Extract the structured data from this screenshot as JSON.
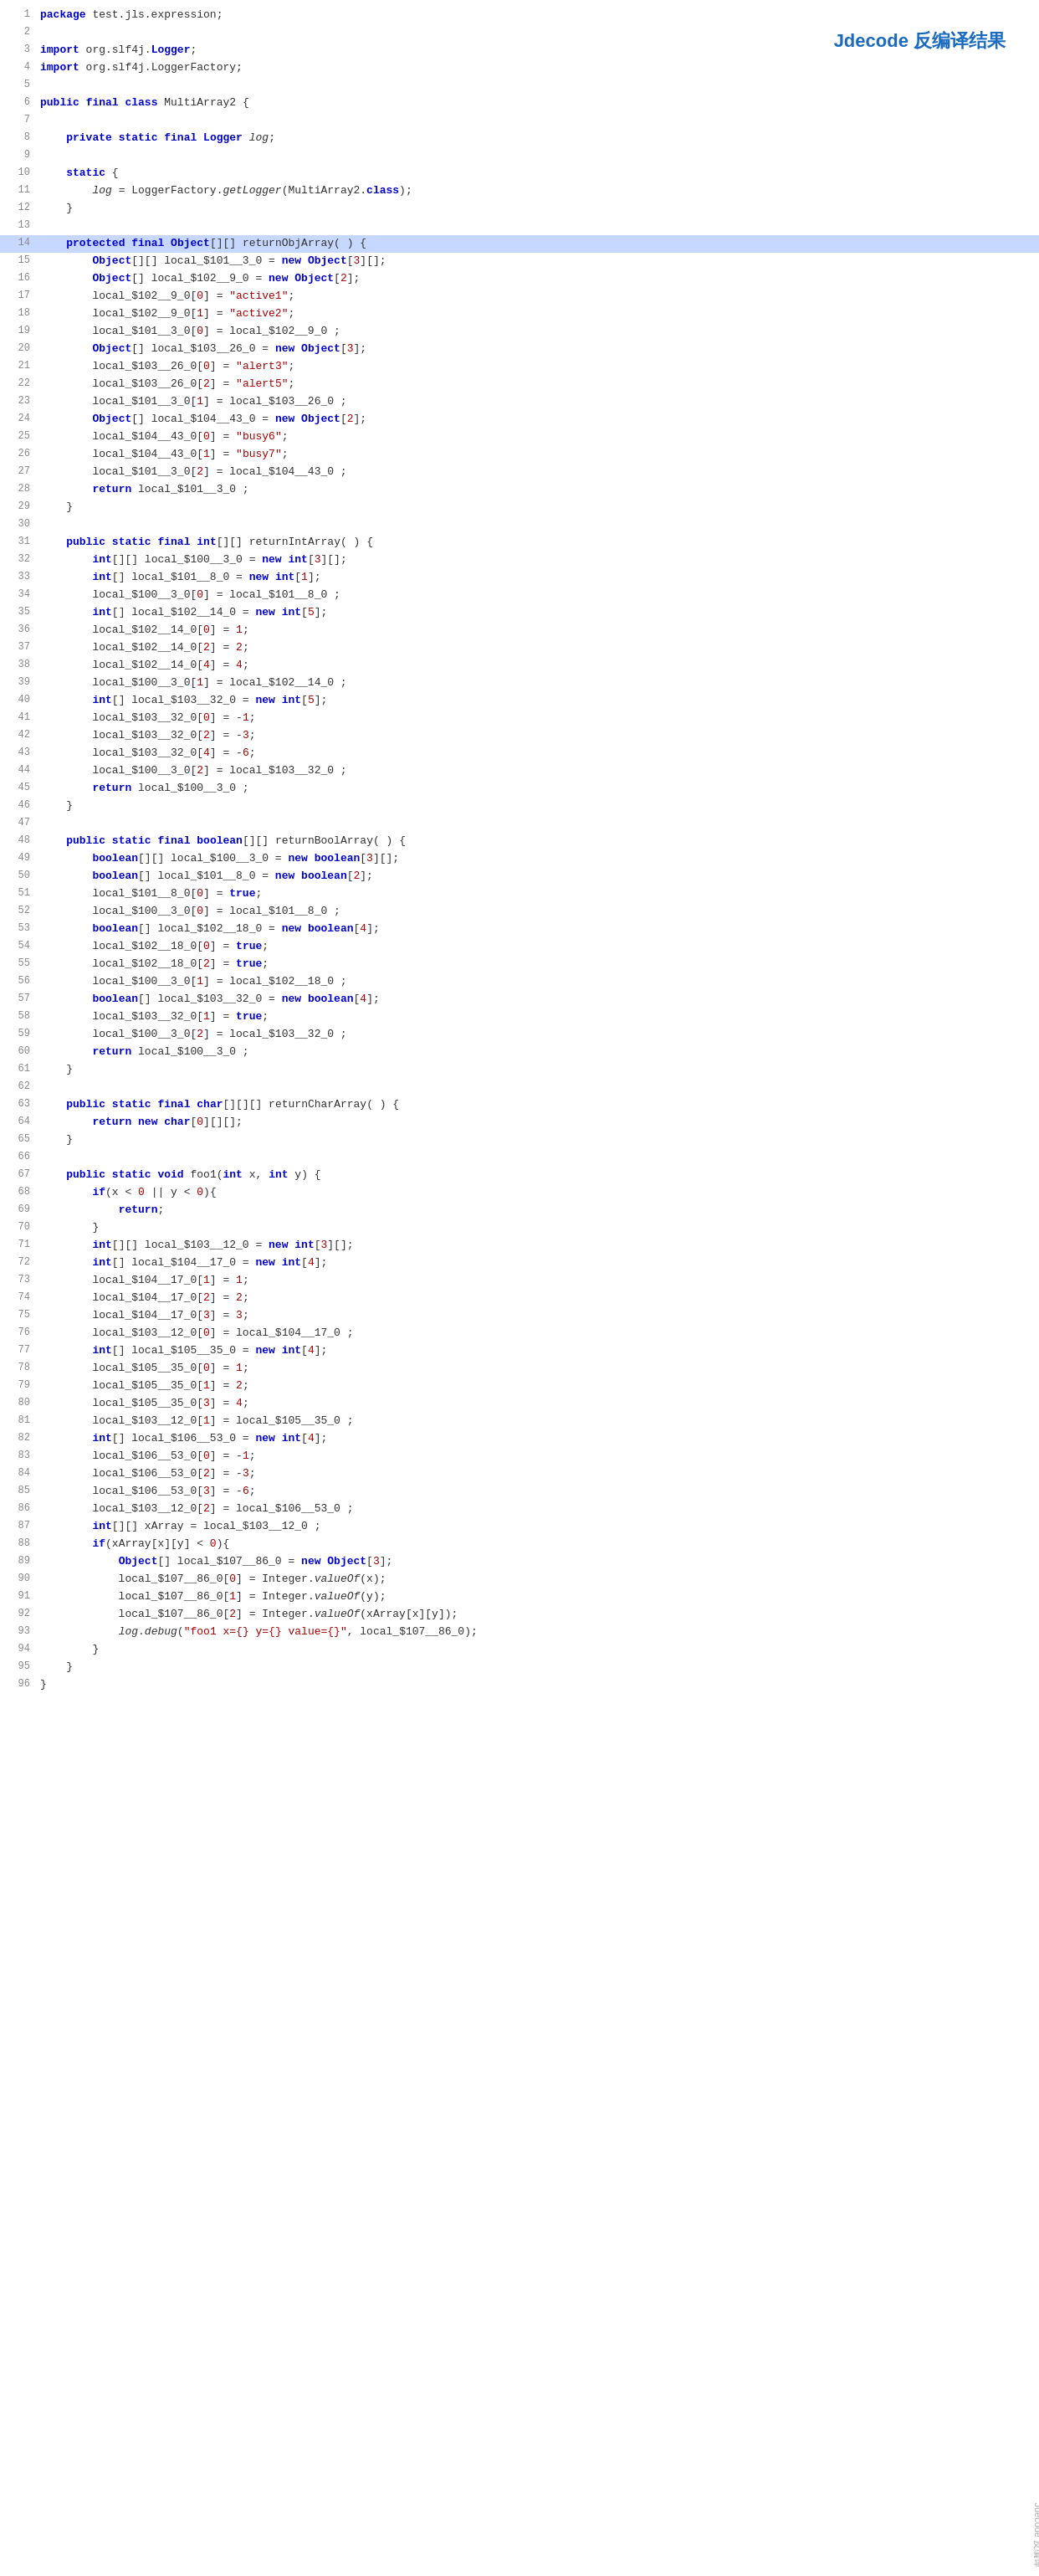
{
  "title": "Jdecode 反编译结果",
  "watermark": "Jdecode 反编译",
  "lines": [
    {
      "num": 1,
      "text": "package test.jls.expression;"
    },
    {
      "num": 2,
      "text": ""
    },
    {
      "num": 3,
      "text": "import org.slf4j.Logger;"
    },
    {
      "num": 4,
      "text": "import org.slf4j.LoggerFactory;"
    },
    {
      "num": 5,
      "text": ""
    },
    {
      "num": 6,
      "text": "public final class MultiArray2 {"
    },
    {
      "num": 7,
      "text": ""
    },
    {
      "num": 8,
      "text": "    private static final Logger log;"
    },
    {
      "num": 9,
      "text": ""
    },
    {
      "num": 10,
      "text": "    static {"
    },
    {
      "num": 11,
      "text": "        log = LoggerFactory.getLogger(MultiArray2.class);"
    },
    {
      "num": 12,
      "text": "    }"
    },
    {
      "num": 13,
      "text": ""
    },
    {
      "num": 14,
      "text": "    protected final Object[][] returnObjArray( ) {",
      "highlight": true
    },
    {
      "num": 15,
      "text": "        Object[][] local_$101__3_0 = new Object[3][];"
    },
    {
      "num": 16,
      "text": "        Object[] local_$102__9_0 = new Object[2];"
    },
    {
      "num": 17,
      "text": "        local_$102__9_0[0] = \"active1\";"
    },
    {
      "num": 18,
      "text": "        local_$102__9_0[1] = \"active2\";"
    },
    {
      "num": 19,
      "text": "        local_$101__3_0[0] = local_$102__9_0 ;"
    },
    {
      "num": 20,
      "text": "        Object[] local_$103__26_0 = new Object[3];"
    },
    {
      "num": 21,
      "text": "        local_$103__26_0[0] = \"alert3\";"
    },
    {
      "num": 22,
      "text": "        local_$103__26_0[2] = \"alert5\";"
    },
    {
      "num": 23,
      "text": "        local_$101__3_0[1] = local_$103__26_0 ;"
    },
    {
      "num": 24,
      "text": "        Object[] local_$104__43_0 = new Object[2];"
    },
    {
      "num": 25,
      "text": "        local_$104__43_0[0] = \"busy6\";"
    },
    {
      "num": 26,
      "text": "        local_$104__43_0[1] = \"busy7\";"
    },
    {
      "num": 27,
      "text": "        local_$101__3_0[2] = local_$104__43_0 ;"
    },
    {
      "num": 28,
      "text": "        return local_$101__3_0 ;"
    },
    {
      "num": 29,
      "text": "    }"
    },
    {
      "num": 30,
      "text": ""
    },
    {
      "num": 31,
      "text": "    public static final int[][] returnIntArray( ) {"
    },
    {
      "num": 32,
      "text": "        int[][] local_$100__3_0 = new int[3][];"
    },
    {
      "num": 33,
      "text": "        int[] local_$101__8_0 = new int[1];"
    },
    {
      "num": 34,
      "text": "        local_$100__3_0[0] = local_$101__8_0 ;"
    },
    {
      "num": 35,
      "text": "        int[] local_$102__14_0 = new int[5];"
    },
    {
      "num": 36,
      "text": "        local_$102__14_0[0] = 1;"
    },
    {
      "num": 37,
      "text": "        local_$102__14_0[2] = 2;"
    },
    {
      "num": 38,
      "text": "        local_$102__14_0[4] = 4;"
    },
    {
      "num": 39,
      "text": "        local_$100__3_0[1] = local_$102__14_0 ;"
    },
    {
      "num": 40,
      "text": "        int[] local_$103__32_0 = new int[5];"
    },
    {
      "num": 41,
      "text": "        local_$103__32_0[0] = -1;"
    },
    {
      "num": 42,
      "text": "        local_$103__32_0[2] = -3;"
    },
    {
      "num": 43,
      "text": "        local_$103__32_0[4] = -6;"
    },
    {
      "num": 44,
      "text": "        local_$100__3_0[2] = local_$103__32_0 ;"
    },
    {
      "num": 45,
      "text": "        return local_$100__3_0 ;"
    },
    {
      "num": 46,
      "text": "    }"
    },
    {
      "num": 47,
      "text": ""
    },
    {
      "num": 48,
      "text": "    public static final boolean[][] returnBoolArray( ) {"
    },
    {
      "num": 49,
      "text": "        boolean[][] local_$100__3_0 = new boolean[3][];"
    },
    {
      "num": 50,
      "text": "        boolean[] local_$101__8_0 = new boolean[2];"
    },
    {
      "num": 51,
      "text": "        local_$101__8_0[0] = true;"
    },
    {
      "num": 52,
      "text": "        local_$100__3_0[0] = local_$101__8_0 ;"
    },
    {
      "num": 53,
      "text": "        boolean[] local_$102__18_0 = new boolean[4];"
    },
    {
      "num": 54,
      "text": "        local_$102__18_0[0] = true;"
    },
    {
      "num": 55,
      "text": "        local_$102__18_0[2] = true;"
    },
    {
      "num": 56,
      "text": "        local_$100__3_0[1] = local_$102__18_0 ;"
    },
    {
      "num": 57,
      "text": "        boolean[] local_$103__32_0 = new boolean[4];"
    },
    {
      "num": 58,
      "text": "        local_$103__32_0[1] = true;"
    },
    {
      "num": 59,
      "text": "        local_$100__3_0[2] = local_$103__32_0 ;"
    },
    {
      "num": 60,
      "text": "        return local_$100__3_0 ;"
    },
    {
      "num": 61,
      "text": "    }"
    },
    {
      "num": 62,
      "text": ""
    },
    {
      "num": 63,
      "text": "    public static final char[][][] returnCharArray( ) {"
    },
    {
      "num": 64,
      "text": "        return new char[0][][];"
    },
    {
      "num": 65,
      "text": "    }"
    },
    {
      "num": 66,
      "text": ""
    },
    {
      "num": 67,
      "text": "    public static void foo1(int x, int y) {"
    },
    {
      "num": 68,
      "text": "        if(x < 0 || y < 0){"
    },
    {
      "num": 69,
      "text": "            return;"
    },
    {
      "num": 70,
      "text": "        }"
    },
    {
      "num": 71,
      "text": "        int[][] local_$103__12_0 = new int[3][];"
    },
    {
      "num": 72,
      "text": "        int[] local_$104__17_0 = new int[4];"
    },
    {
      "num": 73,
      "text": "        local_$104__17_0[1] = 1;"
    },
    {
      "num": 74,
      "text": "        local_$104__17_0[2] = 2;"
    },
    {
      "num": 75,
      "text": "        local_$104__17_0[3] = 3;"
    },
    {
      "num": 76,
      "text": "        local_$103__12_0[0] = local_$104__17_0 ;"
    },
    {
      "num": 77,
      "text": "        int[] local_$105__35_0 = new int[4];"
    },
    {
      "num": 78,
      "text": "        local_$105__35_0[0] = 1;"
    },
    {
      "num": 79,
      "text": "        local_$105__35_0[1] = 2;"
    },
    {
      "num": 80,
      "text": "        local_$105__35_0[3] = 4;"
    },
    {
      "num": 81,
      "text": "        local_$103__12_0[1] = local_$105__35_0 ;"
    },
    {
      "num": 82,
      "text": "        int[] local_$106__53_0 = new int[4];"
    },
    {
      "num": 83,
      "text": "        local_$106__53_0[0] = -1;"
    },
    {
      "num": 84,
      "text": "        local_$106__53_0[2] = -3;"
    },
    {
      "num": 85,
      "text": "        local_$106__53_0[3] = -6;"
    },
    {
      "num": 86,
      "text": "        local_$103__12_0[2] = local_$106__53_0 ;"
    },
    {
      "num": 87,
      "text": "        int[][] xArray = local_$103__12_0 ;"
    },
    {
      "num": 88,
      "text": "        if(xArray[x][y] < 0){"
    },
    {
      "num": 89,
      "text": "            Object[] local_$107__86_0 = new Object[3];"
    },
    {
      "num": 90,
      "text": "            local_$107__86_0[0] = Integer.valueOf(x);"
    },
    {
      "num": 91,
      "text": "            local_$107__86_0[1] = Integer.valueOf(y);"
    },
    {
      "num": 92,
      "text": "            local_$107__86_0[2] = Integer.valueOf(xArray[x][y]);"
    },
    {
      "num": 93,
      "text": "            log.debug(\"foo1 x={} y={} value={}\", local_$107__86_0);"
    },
    {
      "num": 94,
      "text": "        }"
    },
    {
      "num": 95,
      "text": "    }"
    },
    {
      "num": 96,
      "text": "}"
    }
  ]
}
